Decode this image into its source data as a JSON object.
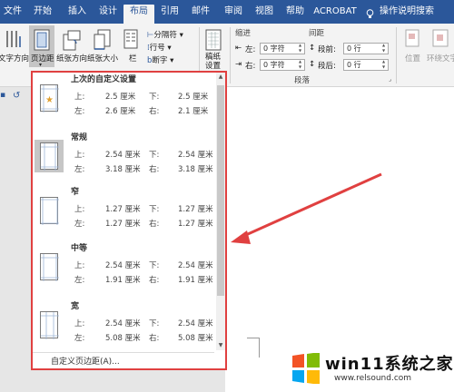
{
  "tabs": [
    {
      "label": "文件"
    },
    {
      "label": "开始"
    },
    {
      "label": "插入"
    },
    {
      "label": "设计"
    },
    {
      "label": "布局"
    },
    {
      "label": "引用"
    },
    {
      "label": "邮件"
    },
    {
      "label": "审阅"
    },
    {
      "label": "视图"
    },
    {
      "label": "帮助"
    },
    {
      "label": "ACROBAT"
    }
  ],
  "tell_me": "操作说明搜索",
  "ribbon": {
    "text_direction": "文字方向",
    "margins": "页边距",
    "orientation": "纸张方向",
    "size": "纸张大小",
    "columns": "栏",
    "breaks": "分隔符",
    "line_numbers": "行号",
    "hyphenation": "断字",
    "manuscript": "稿纸设置",
    "indent_label": "缩进",
    "spacing_label": "间距",
    "indent_left_label": "左:",
    "indent_left_value": "0 字符",
    "indent_right_label": "右:",
    "indent_right_value": "0 字符",
    "space_before_label": "段前:",
    "space_before_value": "0 行",
    "space_after_label": "段后:",
    "space_after_value": "0 行",
    "paragraph_group": "段落",
    "position": "位置",
    "wrap_text": "环绕文字"
  },
  "margins_menu": {
    "options": [
      {
        "name": "上次的自定义设置",
        "top_label": "上:",
        "top": "2.5 厘米",
        "bottom_label": "下:",
        "bottom": "2.5 厘米",
        "left_label": "左:",
        "left": "2.6 厘米",
        "right_label": "右:",
        "right": "2.1 厘米"
      },
      {
        "name": "常规",
        "top_label": "上:",
        "top": "2.54 厘米",
        "bottom_label": "下:",
        "bottom": "2.54 厘米",
        "left_label": "左:",
        "left": "3.18 厘米",
        "right_label": "右:",
        "right": "3.18 厘米"
      },
      {
        "name": "窄",
        "top_label": "上:",
        "top": "1.27 厘米",
        "bottom_label": "下:",
        "bottom": "1.27 厘米",
        "left_label": "左:",
        "left": "1.27 厘米",
        "right_label": "右:",
        "right": "1.27 厘米"
      },
      {
        "name": "中等",
        "top_label": "上:",
        "top": "2.54 厘米",
        "bottom_label": "下:",
        "bottom": "2.54 厘米",
        "left_label": "左:",
        "left": "1.91 厘米",
        "right_label": "右:",
        "right": "1.91 厘米"
      },
      {
        "name": "宽",
        "top_label": "上:",
        "top": "2.54 厘米",
        "bottom_label": "下:",
        "bottom": "2.54 厘米",
        "left_label": "左:",
        "left": "5.08 厘米",
        "right_label": "右:",
        "right": "5.08 厘米"
      }
    ],
    "custom": "自定义页边距(A)..."
  },
  "watermark": {
    "brand": "win11系统之家",
    "url": "www.relsound.com"
  },
  "colors": {
    "accent": "#2b579a",
    "highlight": "#e04040"
  }
}
